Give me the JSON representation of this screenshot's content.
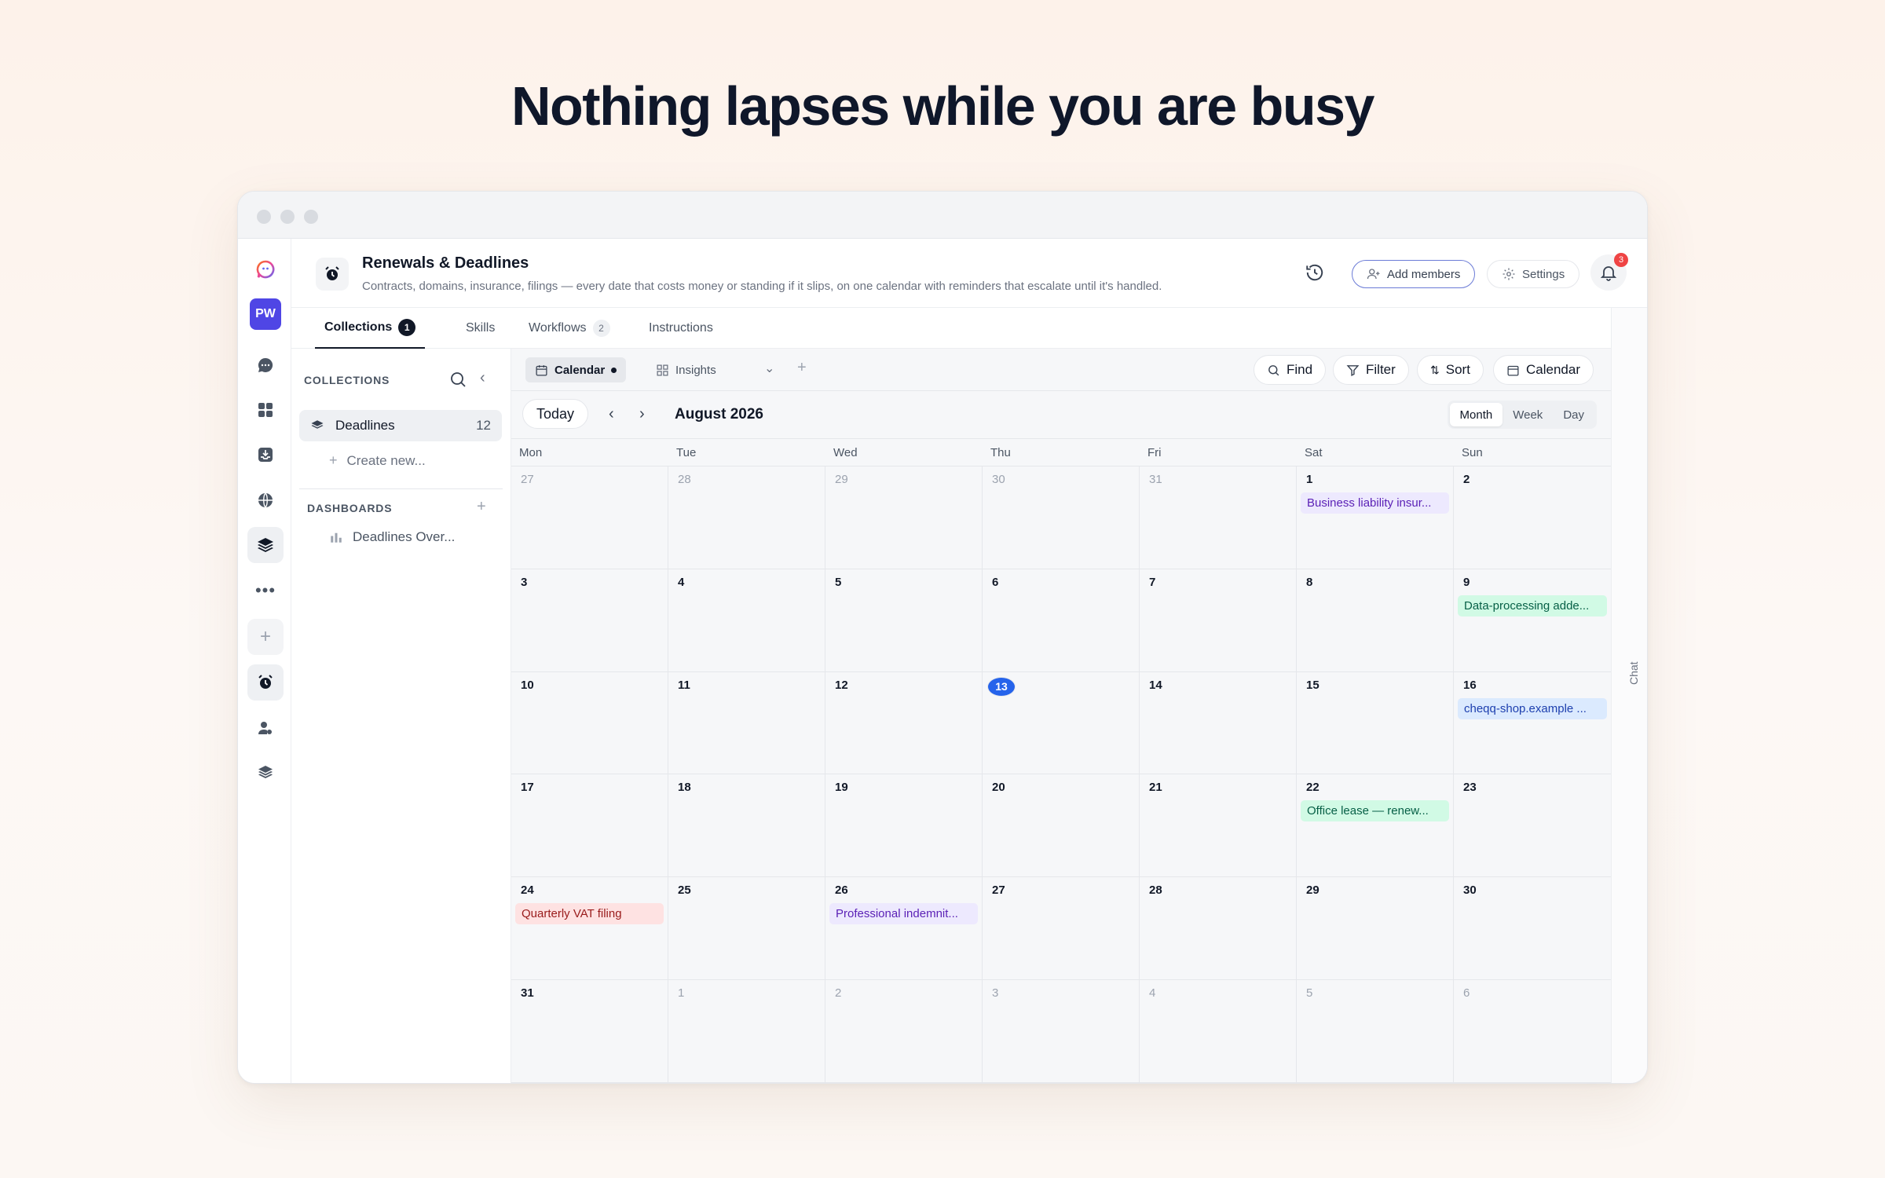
{
  "hero": {
    "title": "Nothing lapses while you are busy"
  },
  "rail": {
    "workspace_initials": "PW"
  },
  "header": {
    "title": "Renewals & Deadlines",
    "subtitle": "Contracts, domains, insurance, filings — every date that costs money or standing if it slips, on one calendar with reminders that escalate until it's handled.",
    "add_members": "Add members",
    "settings": "Settings",
    "notifications_count": "3"
  },
  "tabs": [
    {
      "label": "Collections",
      "count": "1"
    },
    {
      "label": "Skills"
    },
    {
      "label": "Workflows",
      "count": "2"
    },
    {
      "label": "Instructions"
    }
  ],
  "chat_label": "Chat",
  "collections": {
    "heading": "COLLECTIONS",
    "item": {
      "label": "Deadlines",
      "count": "12"
    },
    "create": "Create new...",
    "dashboards_heading": "DASHBOARDS",
    "dashboard_item": "Deadlines Over..."
  },
  "views": {
    "calendar": "Calendar",
    "insights": "Insights",
    "find": "Find",
    "filter": "Filter",
    "sort": "Sort",
    "calendar_btn": "Calendar"
  },
  "nav": {
    "today": "Today",
    "month_label": "August 2026",
    "modes": [
      "Month",
      "Week",
      "Day"
    ],
    "active_mode": "Month"
  },
  "weekdays": [
    "Mon",
    "Tue",
    "Wed",
    "Thu",
    "Fri",
    "Sat",
    "Sun"
  ],
  "weeks": [
    [
      {
        "d": "27",
        "m": true
      },
      {
        "d": "28",
        "m": true
      },
      {
        "d": "29",
        "m": true
      },
      {
        "d": "30",
        "m": true
      },
      {
        "d": "31",
        "m": true
      },
      {
        "d": "1",
        "ev": "Business liability insur...",
        "c": "purple"
      },
      {
        "d": "2"
      }
    ],
    [
      {
        "d": "3"
      },
      {
        "d": "4"
      },
      {
        "d": "5"
      },
      {
        "d": "6"
      },
      {
        "d": "7"
      },
      {
        "d": "8"
      },
      {
        "d": "9",
        "ev": "Data-processing adde...",
        "c": "teal"
      }
    ],
    [
      {
        "d": "10"
      },
      {
        "d": "11"
      },
      {
        "d": "12"
      },
      {
        "d": "13",
        "today": true
      },
      {
        "d": "14"
      },
      {
        "d": "15"
      },
      {
        "d": "16",
        "ev": "cheqq-shop.example ...",
        "c": "blue"
      }
    ],
    [
      {
        "d": "17"
      },
      {
        "d": "18"
      },
      {
        "d": "19"
      },
      {
        "d": "20"
      },
      {
        "d": "21"
      },
      {
        "d": "22",
        "ev": "Office lease — renew...",
        "c": "teal"
      },
      {
        "d": "23"
      }
    ],
    [
      {
        "d": "24",
        "ev": "Quarterly VAT filing",
        "c": "red"
      },
      {
        "d": "25"
      },
      {
        "d": "26",
        "ev": "Professional indemnit...",
        "c": "purple"
      },
      {
        "d": "27"
      },
      {
        "d": "28"
      },
      {
        "d": "29"
      },
      {
        "d": "30"
      }
    ],
    [
      {
        "d": "31"
      },
      {
        "d": "1",
        "m": true
      },
      {
        "d": "2",
        "m": true
      },
      {
        "d": "3",
        "m": true
      },
      {
        "d": "4",
        "m": true
      },
      {
        "d": "5",
        "m": true
      },
      {
        "d": "6",
        "m": true
      }
    ]
  ],
  "event_colors": {
    "purple": {
      "bg": "#ede9fe",
      "fg": "#5b21b6"
    },
    "teal": {
      "bg": "#d1fae5",
      "fg": "#065f46"
    },
    "blue": {
      "bg": "#dbeafe",
      "fg": "#1e40af"
    },
    "red": {
      "bg": "#fee2e2",
      "fg": "#991b1b"
    }
  }
}
